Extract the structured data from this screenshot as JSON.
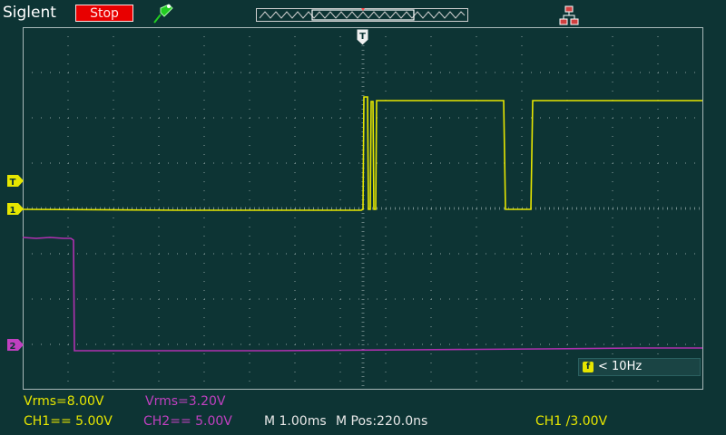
{
  "header": {
    "brand": "Siglent",
    "run_state": "Stop",
    "trigger_marker": "T"
  },
  "icons": [
    "trigger-probe-icon",
    "memory-overview-icon",
    "usb-network-icon"
  ],
  "colors": {
    "background": "#0d3434",
    "channel1": "#e6e600",
    "channel2": "#c040c0",
    "run_stop": "#e80000",
    "grid": "#8aa0a0"
  },
  "channels": {
    "ch1": {
      "marker": "1",
      "trigger_marker": "T",
      "label": "CH1== 5.00V",
      "vrms": "Vrms=8.00V"
    },
    "ch2": {
      "marker": "2",
      "label": "CH2== 5.00V",
      "vrms": "Vrms=3.20V"
    }
  },
  "timebase": {
    "main": "M 1.00ms",
    "position": "M Pos:220.0ns"
  },
  "trigger": {
    "source_level": "CH1 /3.00V"
  },
  "frequency": {
    "badge": "f",
    "text": "< 10Hz"
  }
}
